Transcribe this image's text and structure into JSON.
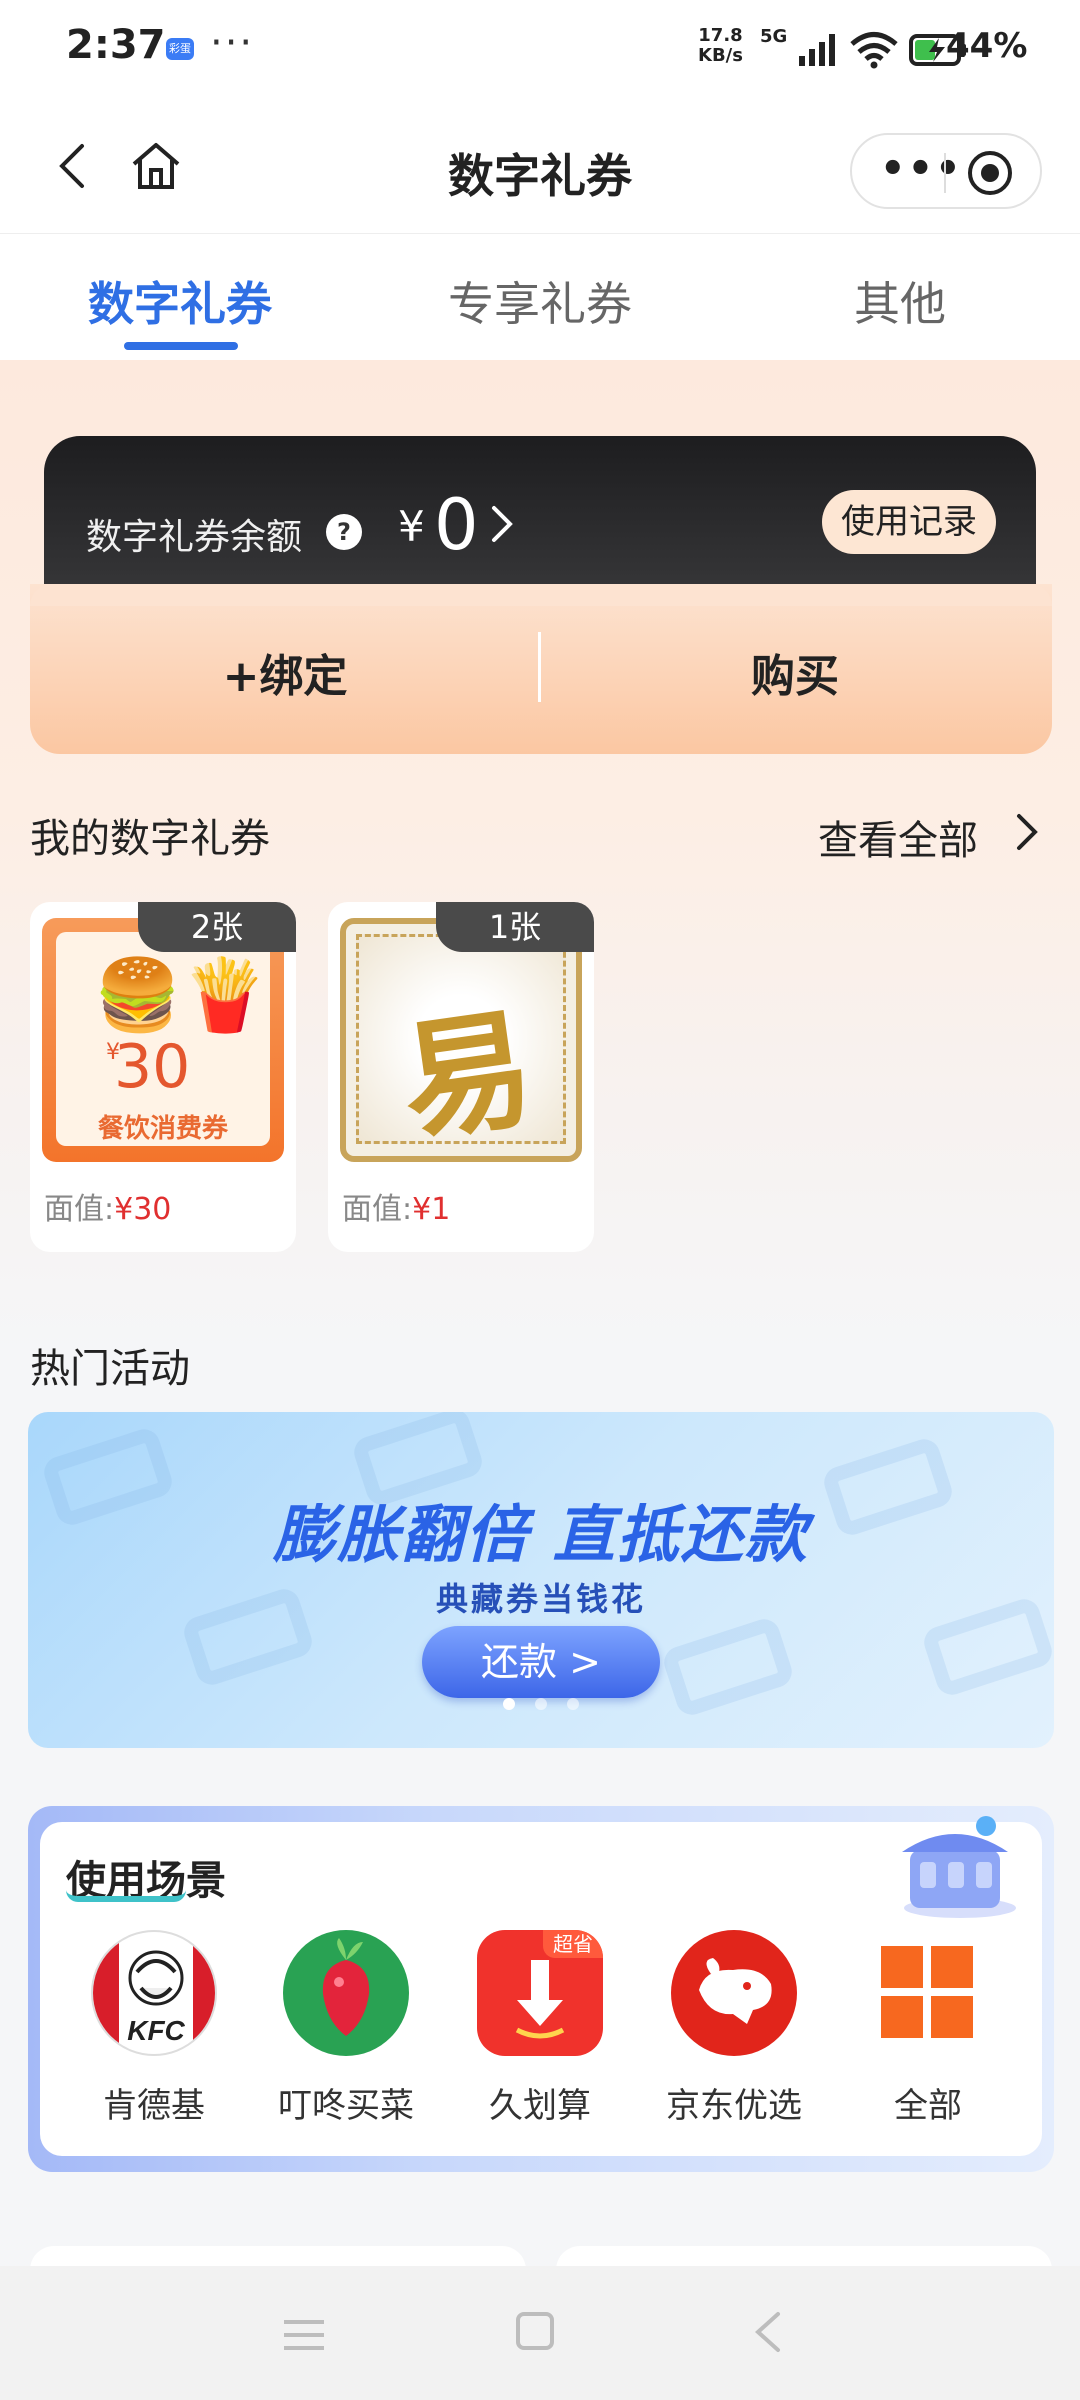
{
  "status_bar": {
    "time": "2:37",
    "app_badge": "彩蛋",
    "more": "···",
    "net_speed_value": "17.8",
    "net_speed_unit": "KB/s",
    "network_type": "5G",
    "battery": "44%",
    "icons": [
      "signal-icon",
      "wifi-icon",
      "battery-charging-icon"
    ]
  },
  "nav": {
    "title": "数字礼券",
    "back_icon": "back-chevron-icon",
    "home_icon": "home-icon",
    "capsule": {
      "more": "•••",
      "close_icon": "target-icon"
    }
  },
  "tabs": [
    {
      "label": "数字礼券",
      "active": true
    },
    {
      "label": "专享礼券",
      "active": false
    },
    {
      "label": "其他",
      "active": false
    }
  ],
  "balance": {
    "label": "数字礼券余额",
    "help": "?",
    "currency": "¥",
    "amount": "0",
    "chevron": "›",
    "history_button": "使用记录"
  },
  "actions": {
    "bind": "+绑定",
    "buy": "购买"
  },
  "my_coupons": {
    "title": "我的数字礼券",
    "view_all": "查看全部",
    "items": [
      {
        "count": "2张",
        "face_currency": "¥",
        "face_value": "30",
        "face_label": "餐饮消费券",
        "value_label": "面值:",
        "value": "¥30"
      },
      {
        "count": "1张",
        "face_glyph": "易",
        "value_label": "面值:",
        "value": "¥1"
      }
    ]
  },
  "hot_activities": {
    "title": "热门活动",
    "banner": {
      "headline": "膨胀翻倍 直抵还款",
      "subtitle": "典藏券当钱花",
      "button": "还款 >",
      "dots": 3,
      "active_dot": 0
    }
  },
  "scenes": {
    "title": "使用场景",
    "items": [
      {
        "label": "肯德基",
        "icon": "kfc-logo-icon",
        "logo_text": "KFC"
      },
      {
        "label": "叮咚买菜",
        "icon": "dingdong-radish-icon"
      },
      {
        "label": "久划算",
        "icon": "juhuasuan-arrow-icon",
        "badge": "超省"
      },
      {
        "label": "京东优选",
        "icon": "jd-dog-icon"
      },
      {
        "label": "全部",
        "icon": "grid-all-icon"
      }
    ]
  },
  "colors": {
    "accent": "#2f6fe4",
    "price_red": "#e02f2f",
    "peach": "#fbc7a2",
    "dark_card": "#2a2a2c"
  }
}
